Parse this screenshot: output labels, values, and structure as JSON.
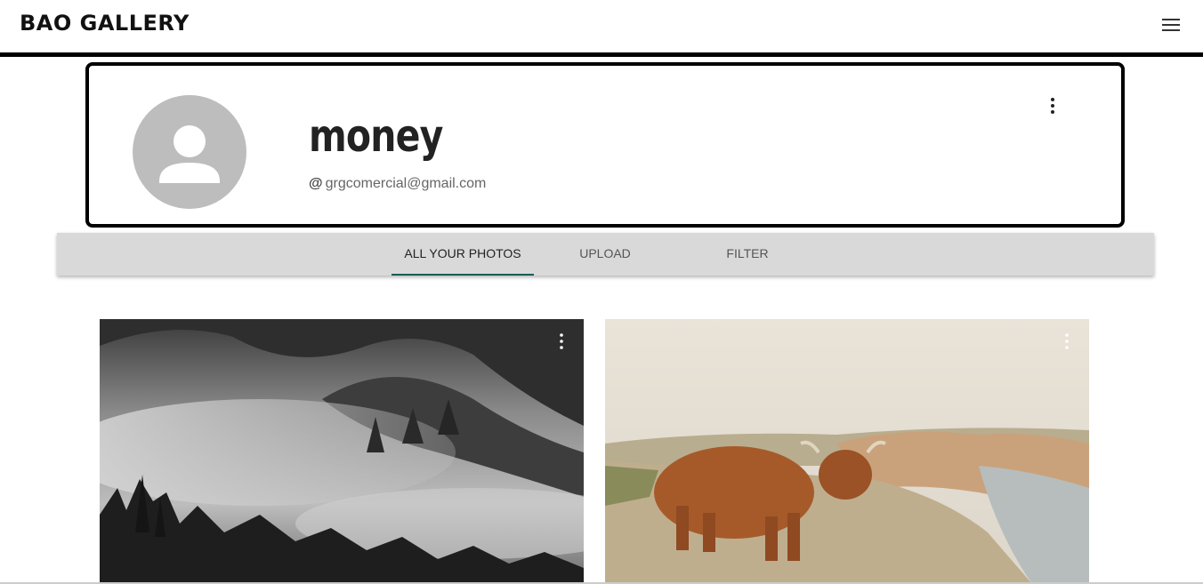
{
  "header": {
    "brand": "BAO GALLERY",
    "menu_icon": "hamburger-menu-icon"
  },
  "profile": {
    "name": "money",
    "email_prefix": "@",
    "email": "grgcomercial@gmail.com",
    "avatar_icon": "person-icon",
    "more_icon": "more-vert-icon"
  },
  "tabs": [
    {
      "label": "ALL YOUR PHOTOS",
      "active": true
    },
    {
      "label": "UPLOAD",
      "active": false
    },
    {
      "label": "FILTER",
      "active": false
    }
  ],
  "photos": [
    {
      "subject": "misty forest black and white",
      "more_icon": "more-vert-icon"
    },
    {
      "subject": "highland cow on rocky shore",
      "more_icon": "more-vert-icon"
    }
  ],
  "colors": {
    "tab_indicator": "#1a5c54",
    "tab_bar": "#d9d9d9",
    "avatar_bg": "#bdbdbd"
  }
}
